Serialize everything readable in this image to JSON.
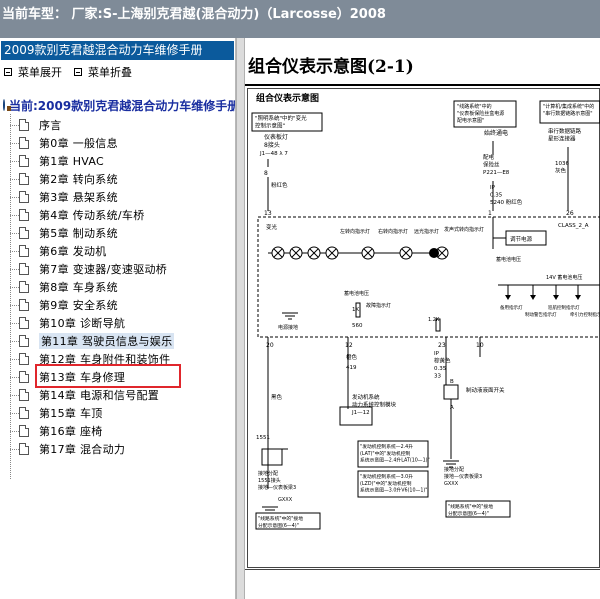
{
  "window": {
    "title": "当前车型： 厂家:S-上海别克君越(混合动力)（Larcosse）2008"
  },
  "sidebar": {
    "header": "2009款别克君越混合动力车维修手册",
    "expand_label": "菜单展开",
    "collapse_label": "菜单折叠",
    "root_label": "当前:2009款别克君越混合动力车维修手册",
    "items": [
      {
        "label": "序言"
      },
      {
        "label": "第0章 一般信息"
      },
      {
        "label": "第1章 HVAC"
      },
      {
        "label": "第2章 转向系统"
      },
      {
        "label": "第3章 悬架系统"
      },
      {
        "label": "第4章 传动系统/车桥"
      },
      {
        "label": "第5章 制动系统"
      },
      {
        "label": "第6章 发动机"
      },
      {
        "label": "第7章 变速器/变速驱动桥"
      },
      {
        "label": "第8章 车身系统"
      },
      {
        "label": "第9章 安全系统"
      },
      {
        "label": "第10章 诊断导航"
      },
      {
        "label": "第11章 驾驶员信息与娱乐"
      },
      {
        "label": "第12章 车身附件和装饰件"
      },
      {
        "label": "第13章 车身修理"
      },
      {
        "label": "第14章 电源和信号配置"
      },
      {
        "label": "第15章 车顶"
      },
      {
        "label": "第16章 座椅"
      },
      {
        "label": "第17章 混合动力"
      }
    ],
    "selected_index": 12,
    "highlight_color": "#e0262c"
  },
  "content": {
    "page_title": "组合仪表示意图(2-1)",
    "diagram": {
      "heading": "组合仪表示意图",
      "note_top_left": [
        "\"照明系统\"中的\"变光",
        "控制示意图\""
      ],
      "fuse_block_label": [
        "仪表板灯",
        "8接头"
      ],
      "conn_j1_48": "J1—48 λ 7",
      "wire_8": "8",
      "color_pink_green": "粉红色",
      "note_power_1": [
        "\"线路系统\"中的",
        "\"仪表板保险丝盒电源",
        "配电示意图\""
      ],
      "note_power_2": [
        "\"计算机/集成系统\"中的",
        "\"串行数据链路示意图\""
      ],
      "always_on": "始终通电",
      "fuse_label": [
        "配电",
        "保险丝",
        "P221—E8"
      ],
      "serial_label": [
        "串行数据链路",
        "星形连接器"
      ],
      "wire_1036": [
        "1036",
        "灰色"
      ],
      "wire_ip": [
        "IP",
        "0.35",
        "5240  粉红色"
      ],
      "pin_13": "13",
      "pin_1": "1",
      "pin_26": "26",
      "class2": "CLASS_2_A",
      "indicator_labels": [
        "变光",
        "左转向指示灯",
        "右转向指示灯",
        "远光指示灯",
        "发声式转向指示灯"
      ],
      "regulator": "调节电源",
      "supply_voltage": "蓄电池电压",
      "v14": "14V  蓄电池电压",
      "lamp_labels": [
        "备用指示灯",
        "制动警告指示灯",
        "巡航控制指示灯",
        "牵引力控制指示灯"
      ],
      "batt_voltage_2": "蓄电池电压",
      "fault_lamp": "故障指示灯",
      "res_1k": "1K",
      "res_560": "560",
      "res_12k": "1.2K",
      "ground_label": "电源接地",
      "pin_20": "20",
      "pin_12": "12",
      "pin_23": "23",
      "pin_10": "10",
      "wire_orange": "橙色",
      "wire_419": "419",
      "wire_ip_brown": [
        "IP",
        "棕黄色",
        "0.35",
        "33"
      ],
      "wire_black": "黑色",
      "brake_switch": "制动液液面开关",
      "pin_b": "B",
      "pin_a": "A",
      "ecm_label": [
        "发动机系统",
        "动力系统控制模块",
        "J1—12"
      ],
      "ecm_note": [
        "\"发动机控制系统—2.4升",
        "(LAT)\"中的\"发动机控制",
        "系统示意图—2.4升LAT(10—1)\""
      ],
      "ecm_note2": [
        "\"发动机控制系统—3.0升",
        "(LZD)\"中的\"发动机控制",
        "系统示意图—3.0升V6(10—1)\""
      ],
      "wire_1551": "1551",
      "ground_left": [
        "接地分配",
        "1551接头",
        "接地—仪表板梁3"
      ],
      "ground_gxxx": "GXXX",
      "note_ground_left": [
        "\"线路系统\"中的\"接地",
        "分配示意图(6—4)\""
      ],
      "ground_right": [
        "接地分配",
        "接地—仪表板梁3",
        "GXXX"
      ],
      "note_ground_right": [
        "\"线路系统\"中的\"接地",
        "分配示意图(6—4)\""
      ]
    }
  }
}
